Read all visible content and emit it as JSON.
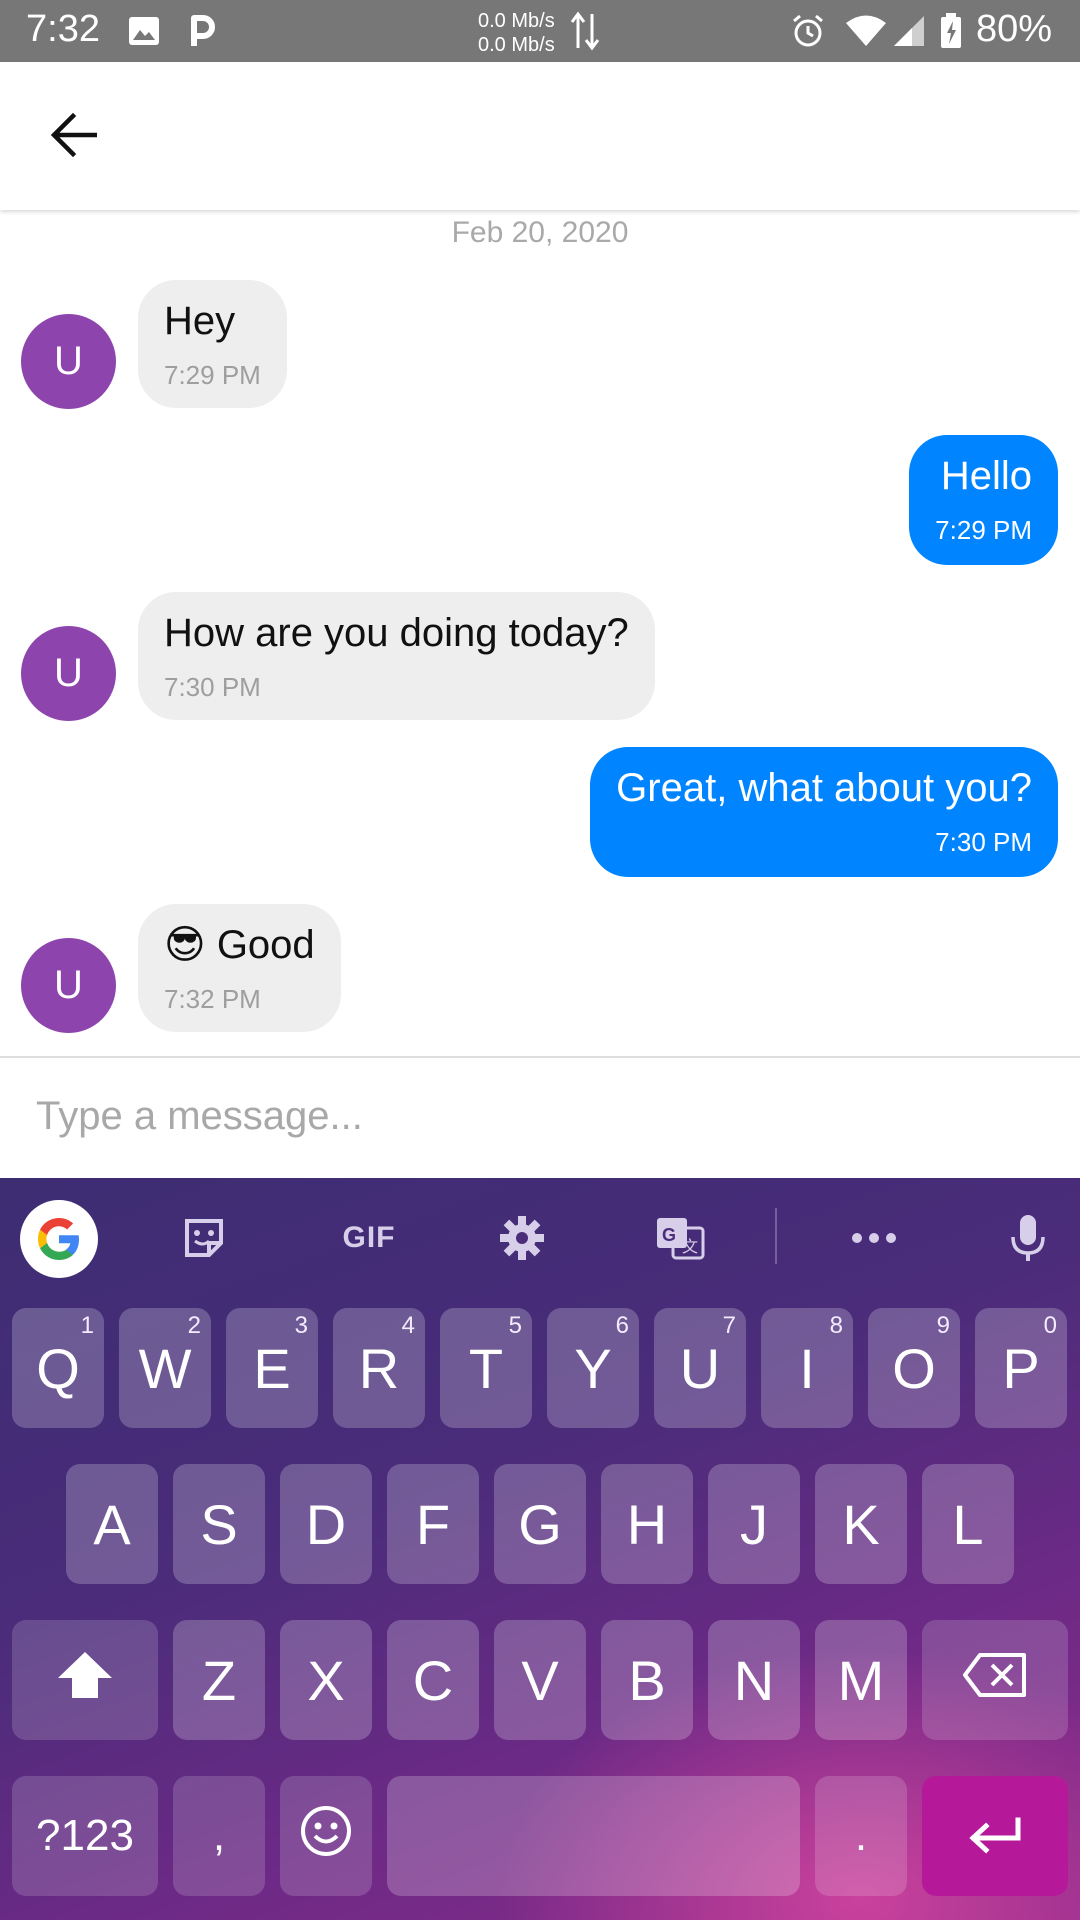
{
  "status_bar": {
    "time": "7:32",
    "net_up": "0.0 Mb/s",
    "net_down": "0.0 Mb/s",
    "battery": "80%",
    "icons": [
      "image-icon",
      "parking-app-icon",
      "data-arrows-icon",
      "alarm-icon",
      "wifi-icon",
      "signal-icon",
      "battery-charging-icon"
    ]
  },
  "toolbar": {
    "back_icon": "arrow-back-icon"
  },
  "chat": {
    "date": "Feb 20, 2020",
    "messages": [
      {
        "direction": "in",
        "avatar": "U",
        "text": "Hey",
        "time": "7:29 PM"
      },
      {
        "direction": "out",
        "text": "Hello",
        "time": "7:29 PM"
      },
      {
        "direction": "in",
        "avatar": "U",
        "text": "How are you doing today?",
        "time": "7:30 PM"
      },
      {
        "direction": "out",
        "text": "Great, what about you?",
        "time": "7:30 PM"
      },
      {
        "direction": "in",
        "avatar": "U",
        "text": "😎 Good",
        "time": "7:32 PM"
      }
    ],
    "colors": {
      "incoming": "#eeeeee",
      "outgoing": "#0084ff",
      "avatar": "#8e44ad"
    }
  },
  "composer": {
    "placeholder": "Type a message...",
    "value": ""
  },
  "keyboard": {
    "toolbar": {
      "gif": "GIF",
      "icons": [
        "google-icon",
        "sticker-icon",
        "gif-icon",
        "settings-gear-icon",
        "translate-icon",
        "more-icon",
        "microphone-icon"
      ]
    },
    "row1": [
      {
        "key": "Q",
        "hint": "1"
      },
      {
        "key": "W",
        "hint": "2"
      },
      {
        "key": "E",
        "hint": "3"
      },
      {
        "key": "R",
        "hint": "4"
      },
      {
        "key": "T",
        "hint": "5"
      },
      {
        "key": "Y",
        "hint": "6"
      },
      {
        "key": "U",
        "hint": "7"
      },
      {
        "key": "I",
        "hint": "8"
      },
      {
        "key": "O",
        "hint": "9"
      },
      {
        "key": "P",
        "hint": "0"
      }
    ],
    "row2": [
      "A",
      "S",
      "D",
      "F",
      "G",
      "H",
      "J",
      "K",
      "L"
    ],
    "row3": [
      "Z",
      "X",
      "C",
      "V",
      "B",
      "N",
      "M"
    ],
    "row4": {
      "symbols": "?123",
      "comma": ",",
      "period": "."
    }
  }
}
